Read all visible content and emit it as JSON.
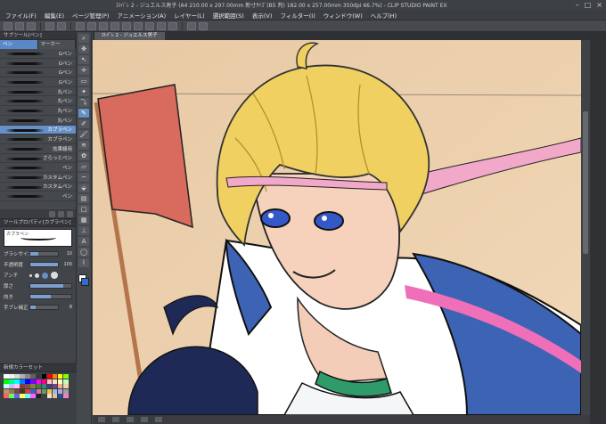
{
  "window": {
    "title": "ｽﾄﾊﾞﾚ 2 - ジュエルス男子 (A4 210.00 x 297.00mm 新寸ｻｲｽﾞ(B5 判) 182.00 x 257.00mm 350dpi 66.7%) - CLIP STUDIO PAINT EX",
    "controls": [
      "–",
      "□",
      "×"
    ]
  },
  "menu": [
    "ファイル(F)",
    "編集(E)",
    "ページ管理(P)",
    "アニメーション(A)",
    "レイヤー(L)",
    "選択範囲(S)",
    "表示(V)",
    "フィルター(I)",
    "ウィンドウ(W)",
    "ヘルプ(H)"
  ],
  "subtool": {
    "header": "サブツール[ペン]",
    "tabs": [
      "ペン",
      "マーカー"
    ],
    "brushes": [
      "Gペン",
      "Gペン",
      "Gペン",
      "Gペン",
      "丸ペン",
      "丸ペン",
      "丸ペン",
      "丸ペン",
      "カブラペン",
      "カブラペン",
      "効果線用",
      "さらっとペン",
      "ペン",
      "カスタムペン",
      "カスタムペン",
      "ペン"
    ],
    "selected_index": 8
  },
  "toolprop": {
    "header": "ツールプロパティ[カブラペン]",
    "preview_label": "カブラペン",
    "brush_size_label": "ブラシサイズ",
    "brush_size_value": "10",
    "opacity_label": "不透明度",
    "opacity_value": "100",
    "aa_label": "アンチ",
    "thickness_label": "厚さ",
    "direction_label": "向き",
    "stabilize_label": "手ブレ補正",
    "stabilize_value": "8"
  },
  "colorset": {
    "header": "新規カラーセット",
    "swatches": [
      "#ffffff",
      "#f0f0f0",
      "#d8d8d8",
      "#b0b0b0",
      "#888888",
      "#606060",
      "#383838",
      "#000000",
      "#ff0000",
      "#ff8000",
      "#ffff00",
      "#80ff00",
      "#00ff00",
      "#00ff80",
      "#00ffff",
      "#0080ff",
      "#0000ff",
      "#8000ff",
      "#ff00ff",
      "#ff0080",
      "#ffc0c0",
      "#ffe0c0",
      "#ffffc0",
      "#c0ffc0",
      "#c0ffff",
      "#c0c0ff",
      "#ffc0ff",
      "#804040",
      "#805040",
      "#808040",
      "#408040",
      "#408080",
      "#404080",
      "#804080",
      "#e8b090",
      "#f0d0b0",
      "#c09070",
      "#a07050",
      "#705030",
      "#503020",
      "#d04040",
      "#4060c0",
      "#e070a0",
      "#60a060",
      "#f0c040",
      "#90c0e0",
      "#c0a0e0",
      "#a0a0a0",
      "#ff6060",
      "#60ff60",
      "#6060ff",
      "#ffff60",
      "#60ffff",
      "#ff60ff",
      "#202020",
      "#404040",
      "#f8e0d0",
      "#e0c0a0",
      "#2050a0",
      "#f080c0"
    ]
  },
  "doc_tab": "ｽﾄﾊﾞﾚ 2 - ジュエルス男子",
  "main_color": "#2f6ed0",
  "sub_color": "#ffffff"
}
